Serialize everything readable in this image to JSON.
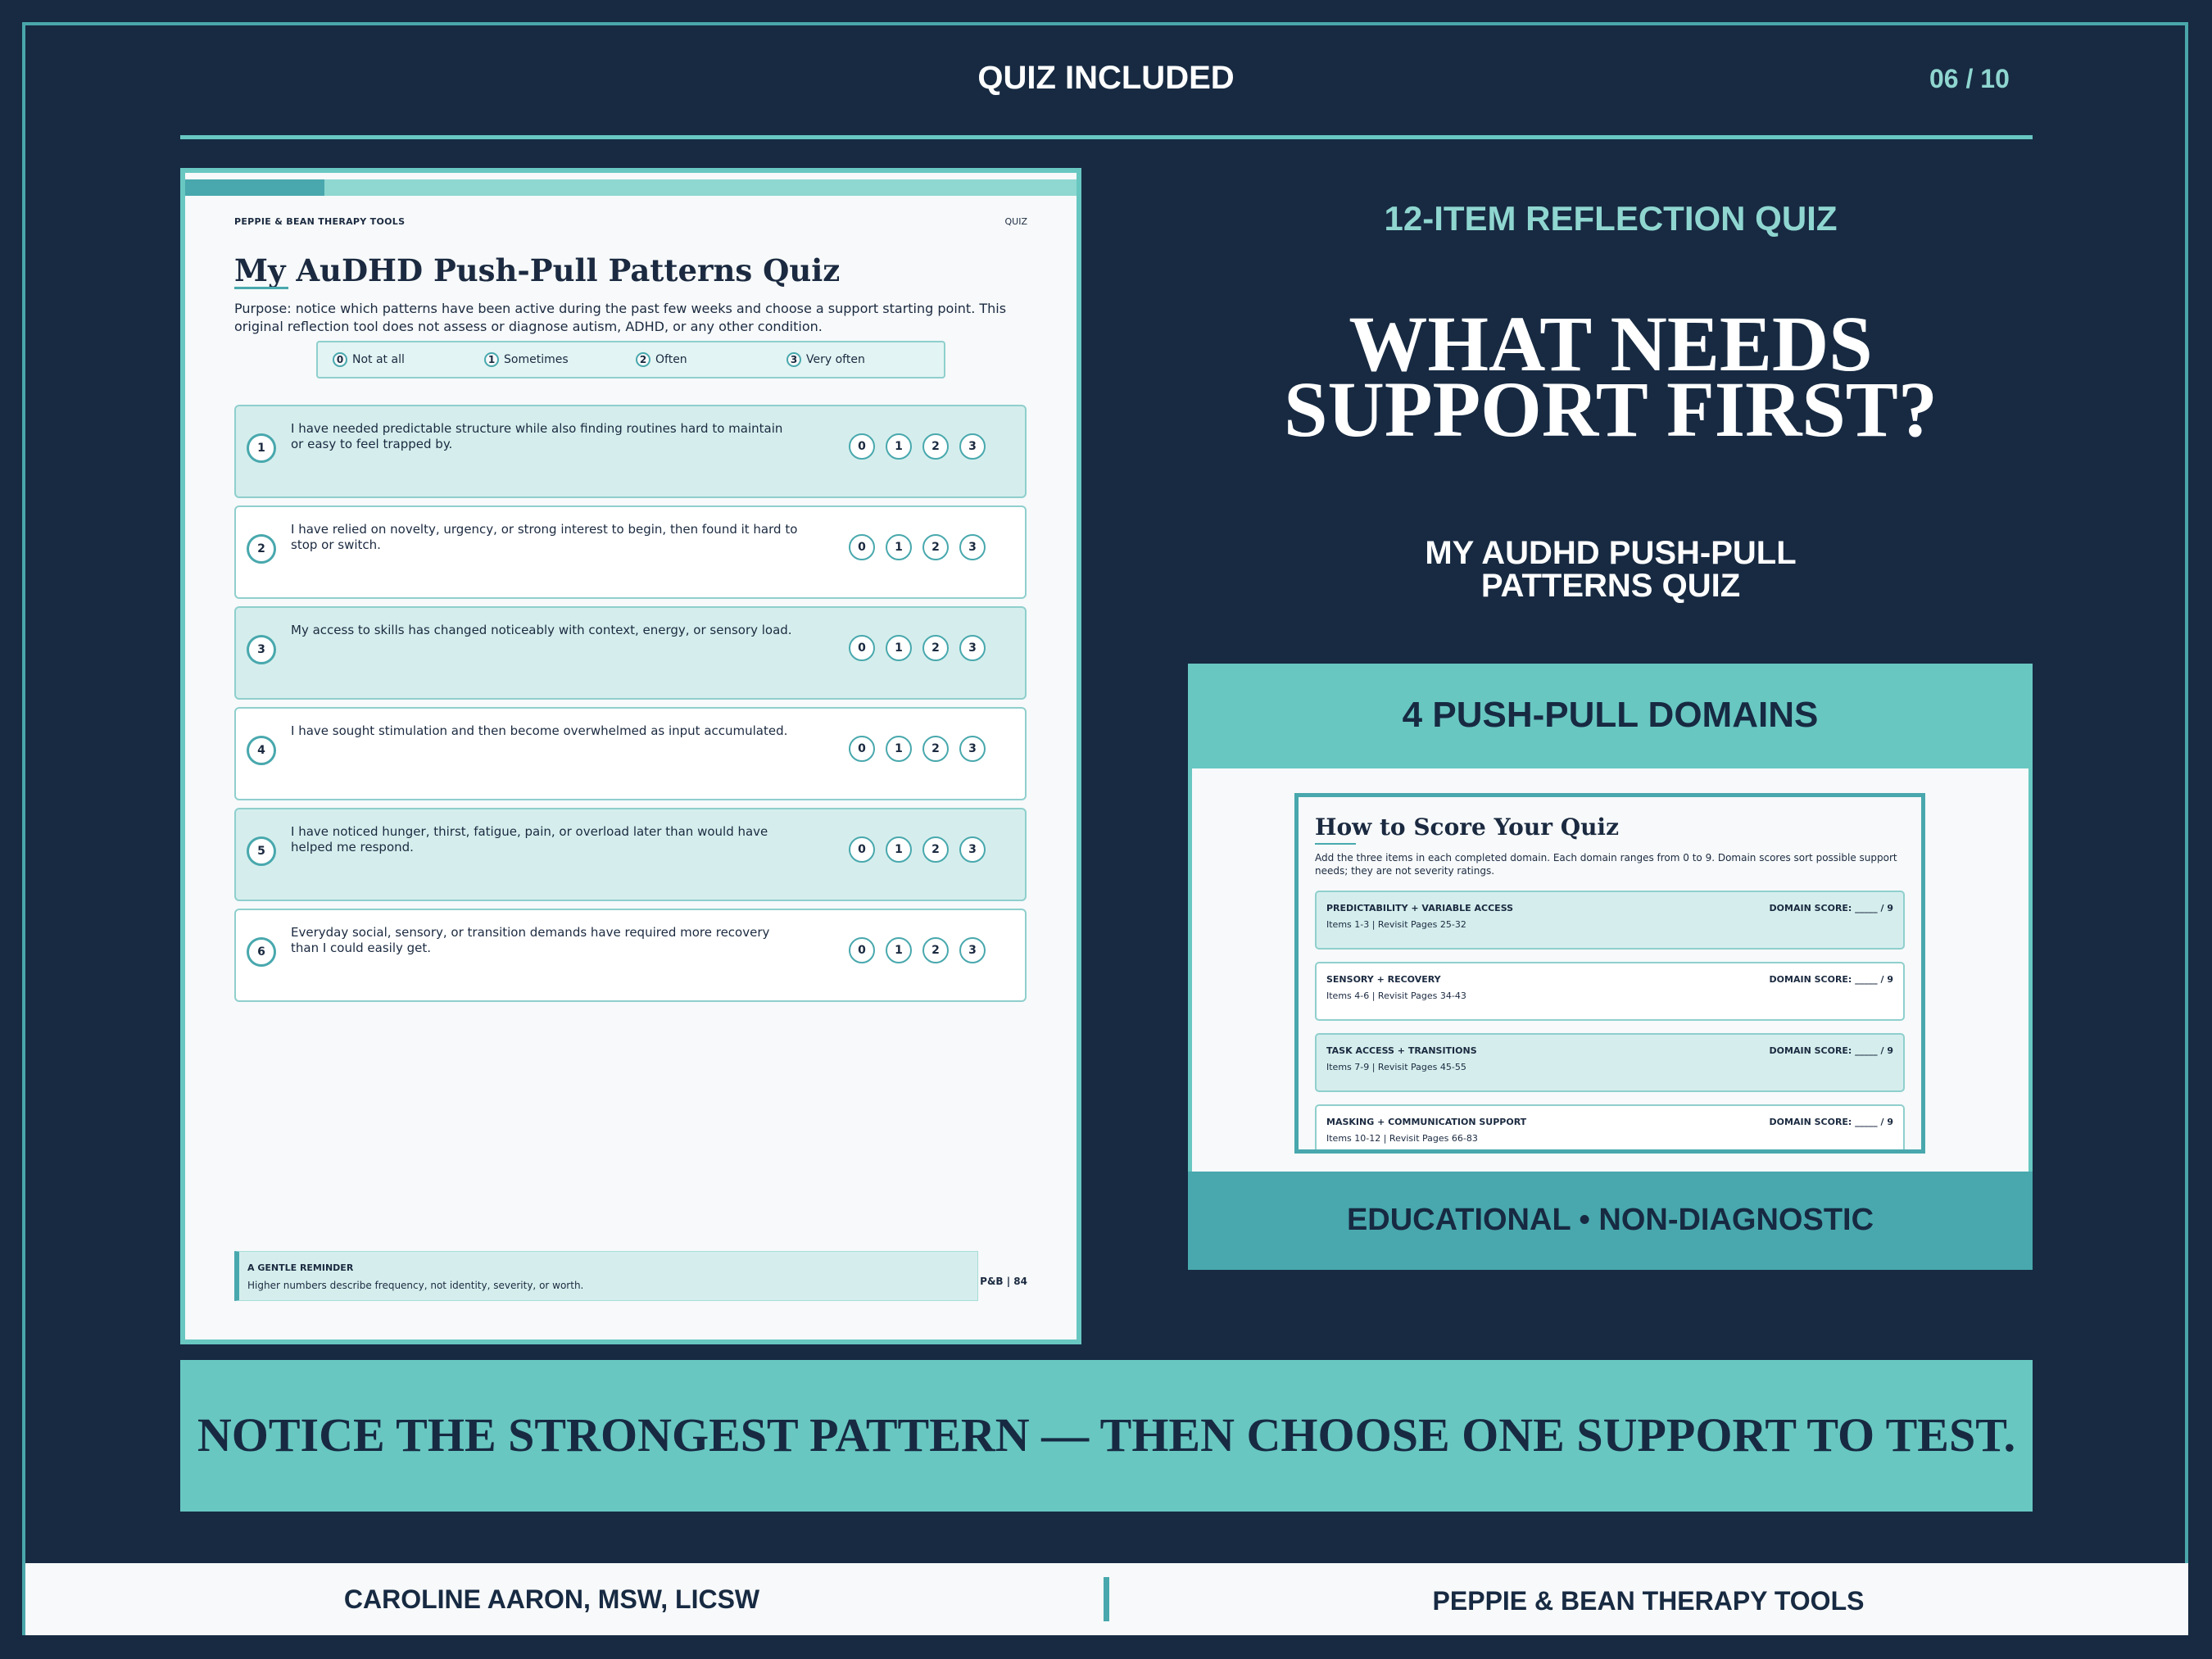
{
  "header": {
    "title": "QUIZ INCLUDED",
    "counter": "06 / 10"
  },
  "quiz_page": {
    "brand": "PEPPIE & BEAN THERAPY TOOLS",
    "section": "QUIZ",
    "title": "My AuDHD Push-Pull Patterns Quiz",
    "purpose": "Purpose: notice which patterns have been active during the past few weeks and choose a support starting point. This original reflection tool does not assess or diagnose autism, ADHD, or any other condition.",
    "scale": [
      {
        "num": "0",
        "label": "Not at all"
      },
      {
        "num": "1",
        "label": "Sometimes"
      },
      {
        "num": "2",
        "label": "Often"
      },
      {
        "num": "3",
        "label": "Very often"
      }
    ],
    "options": [
      "0",
      "1",
      "2",
      "3"
    ],
    "items": [
      {
        "num": "1",
        "text": "I have needed predictable structure while also finding routines hard to maintain or easy to feel trapped by."
      },
      {
        "num": "2",
        "text": "I have relied on novelty, urgency, or strong interest to begin, then found it hard to stop or switch."
      },
      {
        "num": "3",
        "text": "My access to skills has changed noticeably with context, energy, or sensory load."
      },
      {
        "num": "4",
        "text": "I have sought stimulation and then become overwhelmed as input accumulated."
      },
      {
        "num": "5",
        "text": "I have noticed hunger, thirst, fatigue, pain, or overload later than would have helped me respond."
      },
      {
        "num": "6",
        "text": "Everyday social, sensory, or transition demands have required more recovery than I could easily get."
      }
    ],
    "reminder": {
      "title": "A GENTLE REMINDER",
      "text": "Higher numbers describe frequency, not identity, severity, or worth."
    },
    "footer": "P&B | 84"
  },
  "right": {
    "subtitle": "12-ITEM REFLECTION QUIZ",
    "headline_1": "WHAT NEEDS",
    "headline_2": "SUPPORT FIRST?",
    "quiz_name_1": "MY AUDHD PUSH-PULL",
    "quiz_name_2": "PATTERNS QUIZ",
    "domains_title": "4 PUSH-PULL DOMAINS",
    "domains_footer": "EDUCATIONAL • NON-DIAGNOSTIC",
    "score_page": {
      "title": "How to Score Your Quiz",
      "desc": "Add the three items in each completed domain. Each domain ranges from 0 to 9. Domain scores sort possible support needs; they are not severity ratings.",
      "domains": [
        {
          "name": "PREDICTABILITY + VARIABLE ACCESS",
          "score": "DOMAIN SCORE: _____ / 9",
          "items": "Items 1-3  |  Revisit Pages 25-32"
        },
        {
          "name": "SENSORY + RECOVERY",
          "score": "DOMAIN SCORE: _____ / 9",
          "items": "Items 4-6  |  Revisit Pages 34-43"
        },
        {
          "name": "TASK ACCESS + TRANSITIONS",
          "score": "DOMAIN SCORE: _____ / 9",
          "items": "Items 7-9  |  Revisit Pages 45-55"
        },
        {
          "name": "MASKING + COMMUNICATION SUPPORT",
          "score": "DOMAIN SCORE: _____ / 9",
          "items": "Items 10-12  |  Revisit Pages 66-83"
        }
      ]
    }
  },
  "banner": {
    "text": "NOTICE THE STRONGEST PATTERN — THEN CHOOSE ONE SUPPORT TO TEST."
  },
  "footer": {
    "author": "CAROLINE AARON, MSW, LICSW",
    "brand": "PEPPIE & BEAN THERAPY TOOLS"
  },
  "colors": {
    "background": "#172a42",
    "accent": "#68c7c1",
    "accent_dark": "#48a8ad",
    "light_accent": "#8fd6d0",
    "card_shade": "#d5eeed"
  }
}
